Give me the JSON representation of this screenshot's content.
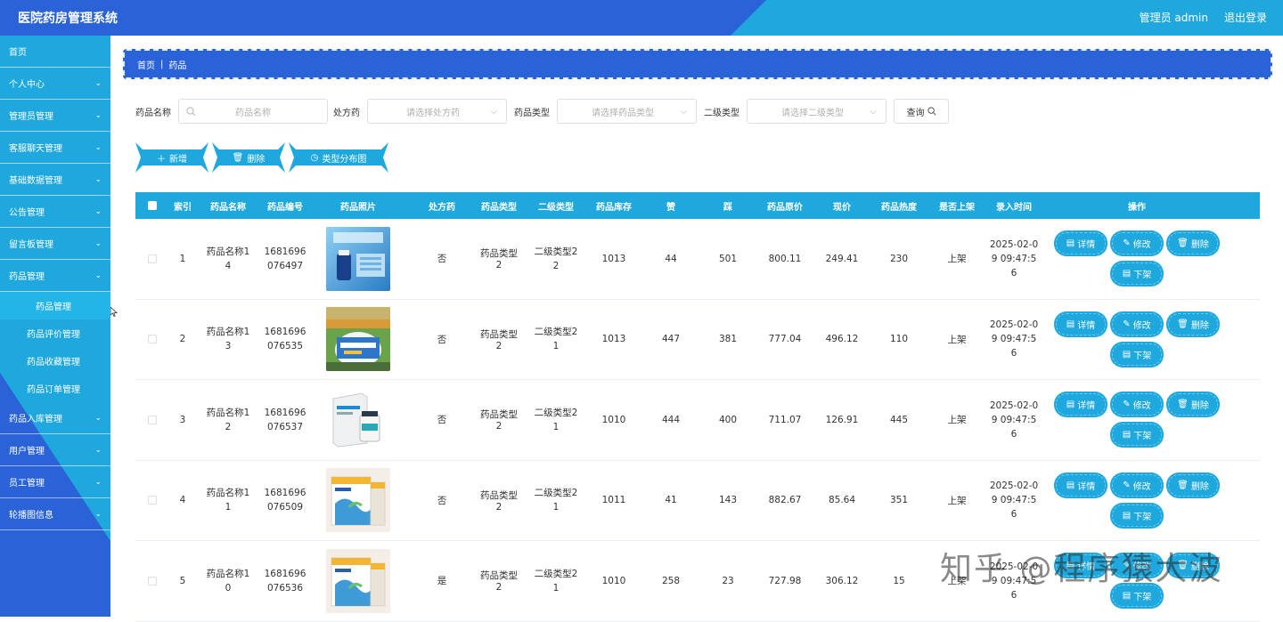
{
  "header": {
    "title": "医院药房管理系统",
    "user_label": "管理员 admin",
    "logout_label": "退出登录"
  },
  "sidebar": {
    "items": [
      {
        "label": "首页",
        "chevron": false
      },
      {
        "label": "个人中心",
        "chevron": true
      },
      {
        "label": "管理员管理",
        "chevron": true
      },
      {
        "label": "客服聊天管理",
        "chevron": true
      },
      {
        "label": "基础数据管理",
        "chevron": true
      },
      {
        "label": "公告管理",
        "chevron": true
      },
      {
        "label": "留言板管理",
        "chevron": true
      },
      {
        "label": "药品管理",
        "chevron": true
      }
    ],
    "sub_items": [
      "药品管理",
      "药品评价管理",
      "药品收藏管理",
      "药品订单管理"
    ],
    "items_after": [
      {
        "label": "药品入库管理",
        "chevron": true
      },
      {
        "label": "用户管理",
        "chevron": true
      },
      {
        "label": "员工管理",
        "chevron": true
      },
      {
        "label": "轮播图信息",
        "chevron": true
      }
    ]
  },
  "breadcrumb": {
    "home": "首页",
    "current": "药品"
  },
  "search": {
    "name_label": "药品名称",
    "name_placeholder": "药品名称",
    "rx_label": "处方药",
    "rx_placeholder": "请选择处方药",
    "type_label": "药品类型",
    "type_placeholder": "请选择药品类型",
    "subtype_label": "二级类型",
    "subtype_placeholder": "请选择二级类型",
    "query_label": "查询"
  },
  "actions": {
    "add_label": "新增",
    "delete_label": "删除",
    "chart_label": "类型分布图"
  },
  "table": {
    "headers": [
      "索引",
      "药品名称",
      "药品编号",
      "药品照片",
      "处方药",
      "药品类型",
      "二级类型",
      "药品库存",
      "赞",
      "踩",
      "药品原价",
      "现价",
      "药品热度",
      "是否上架",
      "录入时间",
      "操作"
    ],
    "op_labels": {
      "detail": "详情",
      "edit": "修改",
      "delete": "删除",
      "offshelf": "下架"
    },
    "rows": [
      {
        "index": "1",
        "name": "药品名称14",
        "code": "1681696076497",
        "rx": "否",
        "type": "药品类型2",
        "subtype": "二级类型22",
        "stock": "1013",
        "up": "44",
        "down": "501",
        "orig": "800.11",
        "price": "249.41",
        "heat": "230",
        "shelf": "上架",
        "time": "2025-02-09 09:47:56",
        "photo": "photo-1"
      },
      {
        "index": "2",
        "name": "药品名称13",
        "code": "1681696076535",
        "rx": "否",
        "type": "药品类型2",
        "subtype": "二级类型21",
        "stock": "1013",
        "up": "447",
        "down": "381",
        "orig": "777.04",
        "price": "496.12",
        "heat": "110",
        "shelf": "上架",
        "time": "2025-02-09 09:47:56",
        "photo": "photo-2"
      },
      {
        "index": "3",
        "name": "药品名称12",
        "code": "1681696076537",
        "rx": "否",
        "type": "药品类型2",
        "subtype": "二级类型21",
        "stock": "1010",
        "up": "444",
        "down": "400",
        "orig": "711.07",
        "price": "126.91",
        "heat": "445",
        "shelf": "上架",
        "time": "2025-02-09 09:47:56",
        "photo": "photo-3"
      },
      {
        "index": "4",
        "name": "药品名称11",
        "code": "1681696076509",
        "rx": "否",
        "type": "药品类型2",
        "subtype": "二级类型21",
        "stock": "1011",
        "up": "41",
        "down": "143",
        "orig": "882.67",
        "price": "85.64",
        "heat": "351",
        "shelf": "上架",
        "time": "2025-02-09 09:47:56",
        "photo": "photo-4"
      },
      {
        "index": "5",
        "name": "药品名称10",
        "code": "1681696076536",
        "rx": "是",
        "type": "药品类型2",
        "subtype": "二级类型21",
        "stock": "1010",
        "up": "258",
        "down": "23",
        "orig": "727.98",
        "price": "306.12",
        "heat": "15",
        "shelf": "上架",
        "time": "2025-02-09 09:47:56",
        "photo": "photo-4"
      }
    ]
  },
  "watermark": "知乎 @程序猿大波",
  "colors": {
    "blue": "#2a62d8",
    "cyan": "#1fa8dd"
  }
}
